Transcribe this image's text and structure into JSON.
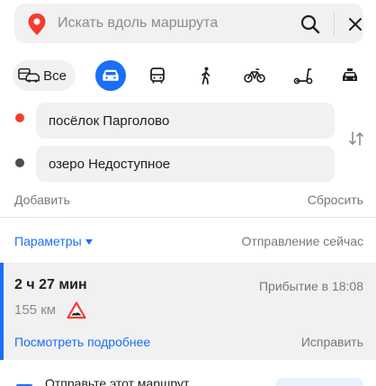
{
  "search": {
    "placeholder": "Искать вдоль маршрута",
    "pin_icon": "map-pin-icon",
    "search_icon": "search-icon",
    "close_icon": "close-icon",
    "pin_color": "#f43b30"
  },
  "modes": {
    "all_label": "Все",
    "items": [
      {
        "name": "all",
        "icon": "car-bus-icon",
        "selected": false
      },
      {
        "name": "car",
        "icon": "car-icon",
        "selected": true
      },
      {
        "name": "bus",
        "icon": "bus-icon",
        "selected": false
      },
      {
        "name": "walk",
        "icon": "pedestrian-icon",
        "selected": false
      },
      {
        "name": "bicycle",
        "icon": "bicycle-icon",
        "selected": false
      },
      {
        "name": "scooter",
        "icon": "scooter-icon",
        "selected": false
      },
      {
        "name": "taxi",
        "icon": "taxi-icon",
        "selected": false
      }
    ],
    "accent_color": "#1a6ef7"
  },
  "route": {
    "from": "посёлок Парголово",
    "to": "озеро Недоступное",
    "from_color": "#f43b30",
    "to_color": "#4d4d4d",
    "swap_icon": "swap-arrows-icon",
    "add_label": "Добавить",
    "reset_label": "Сбросить"
  },
  "options": {
    "params_label": "Параметры",
    "departure_label": "Отправление сейчас"
  },
  "result": {
    "duration": "2 ч 27 мин",
    "arrival": "Прибытие в 18:08",
    "distance": "155 км",
    "warning_icon": "road-works-warning-icon",
    "details_label": "Посмотреть подробнее",
    "fix_label": "Исправить"
  },
  "footer": {
    "text": "Отправьте этот маршрут"
  }
}
